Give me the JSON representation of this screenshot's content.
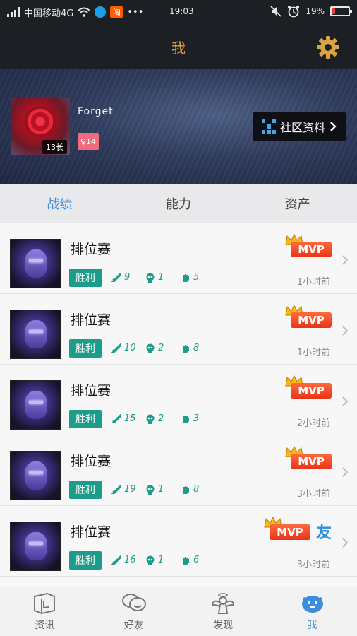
{
  "status_bar": {
    "carrier": "中国移动4G",
    "dots": "•••",
    "time": "19:03",
    "battery": "19%",
    "battery_level": 0.19
  },
  "header": {
    "title": "我"
  },
  "profile": {
    "username": "Forget",
    "level": "13长",
    "gender_age": "♀14",
    "community_button": "社区资料"
  },
  "tabs": [
    {
      "label": "战绩",
      "active": true
    },
    {
      "label": "能力",
      "active": false
    },
    {
      "label": "资产",
      "active": false
    }
  ],
  "matches": [
    {
      "mode": "排位赛",
      "result": "胜利",
      "kills": "9",
      "deaths": "1",
      "assists": "5",
      "time": "1小时前",
      "badge": "MVP",
      "friend": ""
    },
    {
      "mode": "排位赛",
      "result": "胜利",
      "kills": "10",
      "deaths": "2",
      "assists": "8",
      "time": "1小时前",
      "badge": "MVP",
      "friend": ""
    },
    {
      "mode": "排位赛",
      "result": "胜利",
      "kills": "15",
      "deaths": "2",
      "assists": "3",
      "time": "2小时前",
      "badge": "MVP",
      "friend": ""
    },
    {
      "mode": "排位赛",
      "result": "胜利",
      "kills": "19",
      "deaths": "1",
      "assists": "8",
      "time": "3小时前",
      "badge": "MVP",
      "friend": ""
    },
    {
      "mode": "排位赛",
      "result": "胜利",
      "kills": "16",
      "deaths": "1",
      "assists": "6",
      "time": "3小时前",
      "badge": "MVP",
      "friend": "友"
    }
  ],
  "bottom_nav": [
    {
      "label": "资讯",
      "icon": "book-icon",
      "active": false
    },
    {
      "label": "好友",
      "icon": "chat-bubbles-icon",
      "active": false
    },
    {
      "label": "发现",
      "icon": "angel-icon",
      "active": false
    },
    {
      "label": "我",
      "icon": "penguin-icon",
      "active": true
    }
  ],
  "colors": {
    "accent_blue": "#3c8ddb",
    "win_green": "#1d9c8c",
    "mvp_orange": "#e8341a",
    "title_gold": "#d9a441"
  }
}
